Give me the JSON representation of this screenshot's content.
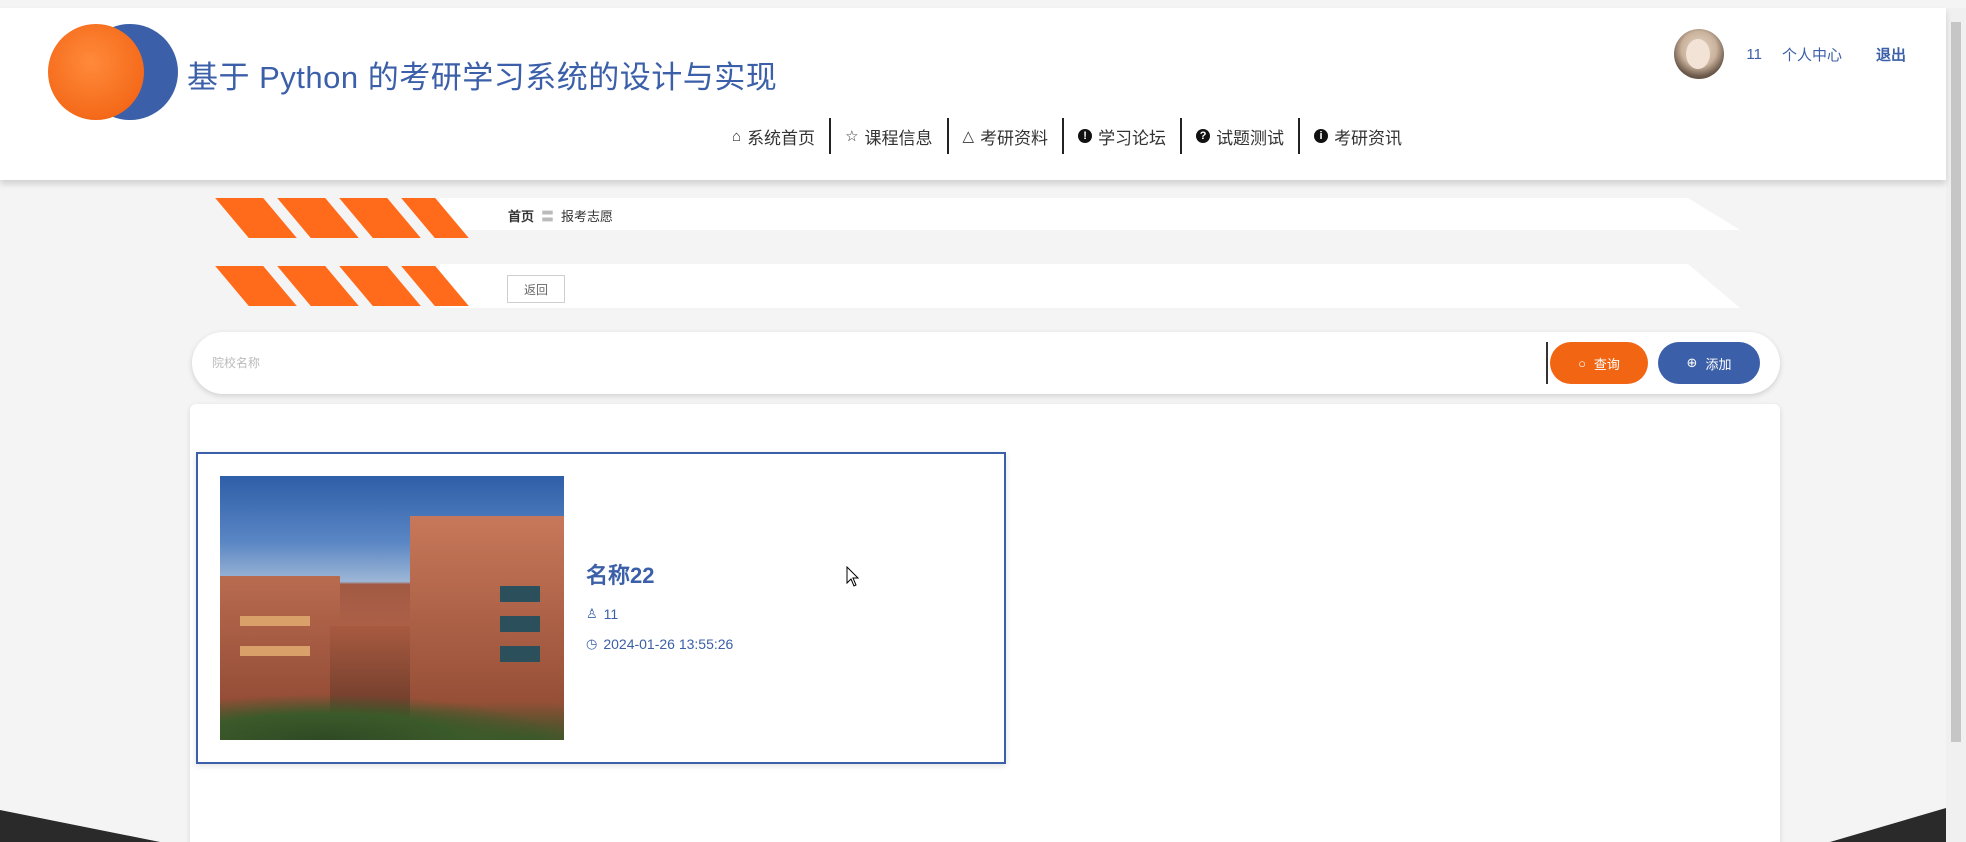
{
  "header": {
    "title": "基于 Python 的考研学习系统的设计与实现",
    "user_name": "11",
    "user_center": "个人中心",
    "logout": "退出"
  },
  "nav": {
    "items": [
      {
        "label": "系统首页",
        "icon": "home-icon"
      },
      {
        "label": "课程信息",
        "icon": "star-icon"
      },
      {
        "label": "考研资料",
        "icon": "bag-icon"
      },
      {
        "label": "学习论坛",
        "icon": "exclamation-icon"
      },
      {
        "label": "试题测试",
        "icon": "question-icon"
      },
      {
        "label": "考研资讯",
        "icon": "info-icon"
      }
    ]
  },
  "breadcrumb": {
    "home": "首页",
    "separator": "〓",
    "current": "报考志愿"
  },
  "back_button": "返回",
  "search": {
    "placeholder": "院校名称",
    "value": "",
    "query_label": "查询",
    "add_label": "添加"
  },
  "cards": [
    {
      "title": "名称22",
      "user": "11",
      "time": "2024-01-26 13:55:26"
    }
  ],
  "colors": {
    "primary": "#3b5fa8",
    "accent": "#f26512"
  }
}
